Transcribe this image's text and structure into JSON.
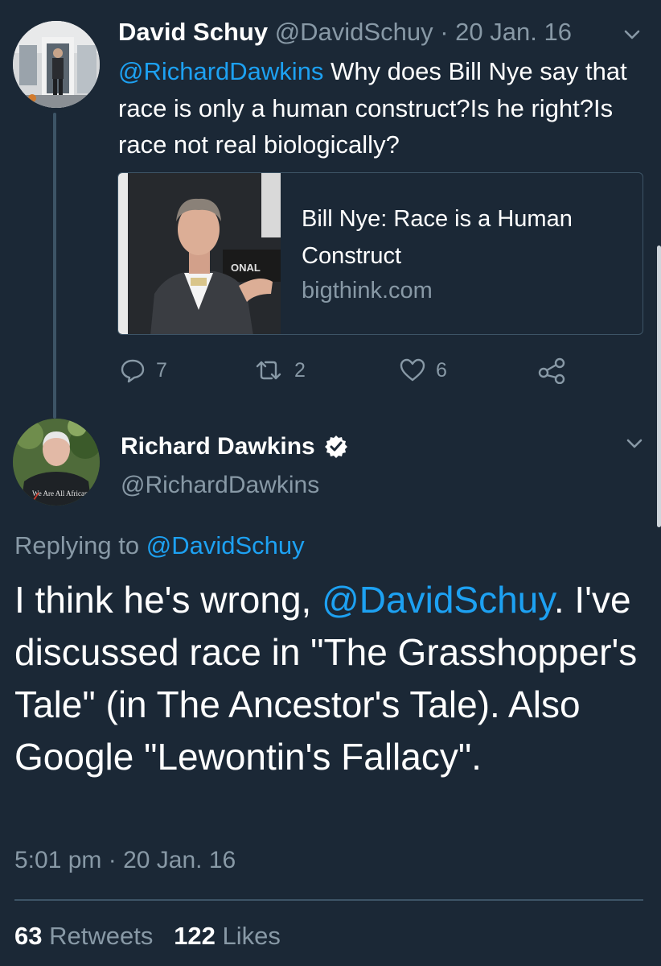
{
  "colors": {
    "background": "#1b2836",
    "link": "#1da1f2",
    "muted": "#8899a6",
    "border": "#3d5466"
  },
  "tweet1": {
    "name": "David Schuy",
    "handle": "@DavidSchuy",
    "separator": "·",
    "date": "20 Jan. 16",
    "mention": "@RichardDawkins",
    "text": "Why does Bill Nye say that race is only a human construct?Is he right?Is race not real biologically?",
    "card": {
      "title": "Bill Nye: Race is a Human Construct",
      "domain": "bigthink.com",
      "image_text": "ONAL"
    },
    "actions": {
      "reply_icon": "reply-icon",
      "reply_count": "7",
      "retweet_icon": "retweet-icon",
      "retweet_count": "2",
      "like_icon": "heart-icon",
      "like_count": "6",
      "share_icon": "share-icon"
    }
  },
  "tweet2": {
    "name": "Richard Dawkins",
    "verified_icon": "verified-badge-icon",
    "handle": "@RichardDawkins",
    "avatar_shirt_text": "We Are All Africans",
    "replying_prefix": "Replying to",
    "replying_to": "@DavidSchuy",
    "text_before": "I think he's wrong,",
    "mention": "@DavidSchuy",
    "text_after": ". I've discussed race in \"The Grasshopper's Tale\" (in The Ancestor's Tale). Also Google \"Lewontin's Fallacy\".",
    "time": "5:01 pm",
    "separator": "·",
    "date": "20 Jan. 16",
    "retweets_count": "63",
    "retweets_label": "Retweets",
    "likes_count": "122",
    "likes_label": "Likes"
  }
}
